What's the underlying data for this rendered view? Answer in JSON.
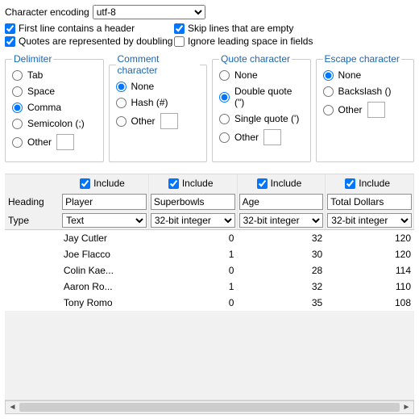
{
  "encoding": {
    "label": "Character encoding",
    "value": "utf-8"
  },
  "checks": {
    "first_line_header": {
      "label": "First line contains a header",
      "checked": true
    },
    "quotes_doubling": {
      "label": "Quotes are represented by doubling",
      "checked": true
    },
    "skip_empty": {
      "label": "Skip lines that are empty",
      "checked": true
    },
    "ignore_leading": {
      "label": "Ignore leading space in fields",
      "checked": false
    }
  },
  "groups": {
    "delimiter": {
      "title": "Delimiter",
      "options": [
        "Tab",
        "Space",
        "Comma",
        "Semicolon (;)",
        "Other"
      ],
      "selected": "Comma"
    },
    "comment": {
      "title": "Comment character",
      "options": [
        "None",
        "Hash (#)",
        "Other"
      ],
      "selected": "None"
    },
    "quote": {
      "title": "Quote character",
      "options": [
        "None",
        "Double quote (\")",
        "Single quote (')",
        "Other"
      ],
      "selected": "Double quote (\")"
    },
    "escape": {
      "title": "Escape character",
      "options": [
        "None",
        "Backslash ()",
        "Other"
      ],
      "selected": "None"
    }
  },
  "col_labels": {
    "include": "Include",
    "heading": "Heading",
    "type": "Type"
  },
  "types": [
    "Text",
    "32-bit integer"
  ],
  "columns": [
    {
      "include": true,
      "heading": "Player",
      "type": "Text"
    },
    {
      "include": true,
      "heading": "Superbowls",
      "type": "32-bit integer"
    },
    {
      "include": true,
      "heading": "Age",
      "type": "32-bit integer"
    },
    {
      "include": true,
      "heading": "Total Dollars",
      "type": "32-bit integer"
    }
  ],
  "rows": [
    {
      "c0": "Jay Cutler",
      "c1": "0",
      "c2": "32",
      "c3": "120"
    },
    {
      "c0": "Joe Flacco",
      "c1": "1",
      "c2": "30",
      "c3": "120"
    },
    {
      "c0": "Colin Kae...",
      "c1": "0",
      "c2": "28",
      "c3": "114"
    },
    {
      "c0": "Aaron Ro...",
      "c1": "1",
      "c2": "32",
      "c3": "110"
    },
    {
      "c0": "Tony Romo",
      "c1": "0",
      "c2": "35",
      "c3": "108"
    }
  ]
}
